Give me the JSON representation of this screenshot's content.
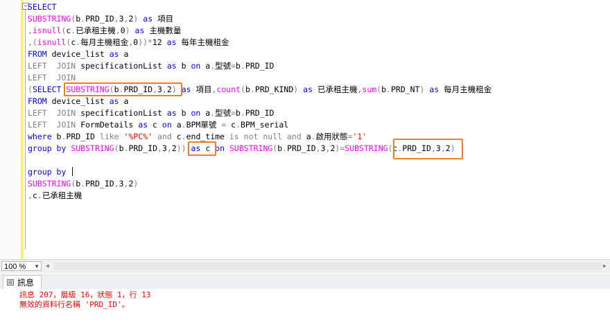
{
  "editor": {
    "lines": [
      [
        {
          "t": "SELECT",
          "c": "k"
        }
      ],
      [
        {
          "t": "SUBSTRING",
          "c": "f"
        },
        {
          "t": "(",
          "c": "g"
        },
        {
          "t": "b",
          "c": ""
        },
        {
          "t": ".",
          "c": "g"
        },
        {
          "t": "PRD_ID",
          "c": ""
        },
        {
          "t": ",",
          "c": "g"
        },
        {
          "t": "3",
          "c": ""
        },
        {
          "t": ",",
          "c": "g"
        },
        {
          "t": "2",
          "c": ""
        },
        {
          "t": ")",
          "c": "g"
        },
        {
          "t": " ",
          "c": ""
        },
        {
          "t": "as",
          "c": "k"
        },
        {
          "t": " 項目",
          "c": ""
        }
      ],
      [
        {
          "t": ",",
          "c": "g"
        },
        {
          "t": "isnull",
          "c": "f"
        },
        {
          "t": "(",
          "c": "g"
        },
        {
          "t": "c",
          "c": ""
        },
        {
          "t": ".",
          "c": "g"
        },
        {
          "t": "已承租主機",
          "c": ""
        },
        {
          "t": ",",
          "c": "g"
        },
        {
          "t": "0",
          "c": ""
        },
        {
          "t": ")",
          "c": "g"
        },
        {
          "t": " ",
          "c": ""
        },
        {
          "t": "as",
          "c": "k"
        },
        {
          "t": " 主機數量",
          "c": ""
        }
      ],
      [
        {
          "t": ",(",
          "c": "g"
        },
        {
          "t": "isnull",
          "c": "f"
        },
        {
          "t": "(",
          "c": "g"
        },
        {
          "t": "c",
          "c": ""
        },
        {
          "t": ".",
          "c": "g"
        },
        {
          "t": "每月主機租金",
          "c": ""
        },
        {
          "t": ",",
          "c": "g"
        },
        {
          "t": "0",
          "c": ""
        },
        {
          "t": "))*",
          "c": "g"
        },
        {
          "t": "12",
          "c": ""
        },
        {
          "t": " ",
          "c": ""
        },
        {
          "t": "as",
          "c": "k"
        },
        {
          "t": " 每年主機租金",
          "c": ""
        }
      ],
      [
        {
          "t": "FROM",
          "c": "k"
        },
        {
          "t": " device_list ",
          "c": ""
        },
        {
          "t": "as",
          "c": "k"
        },
        {
          "t": " a",
          "c": ""
        }
      ],
      [
        {
          "t": "LEFT  JOIN",
          "c": "g"
        },
        {
          "t": " specificationList ",
          "c": ""
        },
        {
          "t": "as",
          "c": "k"
        },
        {
          "t": " b ",
          "c": ""
        },
        {
          "t": "on",
          "c": "k"
        },
        {
          "t": " a",
          "c": ""
        },
        {
          "t": ".",
          "c": "g"
        },
        {
          "t": "型號",
          "c": ""
        },
        {
          "t": "=",
          "c": "g"
        },
        {
          "t": "b",
          "c": ""
        },
        {
          "t": ".",
          "c": "g"
        },
        {
          "t": "PRD_ID",
          "c": ""
        }
      ],
      [
        {
          "t": "LEFT  JOIN",
          "c": "g"
        }
      ],
      [
        {
          "t": "(",
          "c": "g"
        },
        {
          "t": "SELECT",
          "c": "k"
        },
        {
          "t": " ",
          "c": ""
        },
        {
          "t": "SUBSTRING",
          "c": "f"
        },
        {
          "t": "(",
          "c": "g"
        },
        {
          "t": "b",
          "c": ""
        },
        {
          "t": ".",
          "c": "g"
        },
        {
          "t": "PRD_ID",
          "c": ""
        },
        {
          "t": ",",
          "c": "g"
        },
        {
          "t": "3",
          "c": ""
        },
        {
          "t": ",",
          "c": "g"
        },
        {
          "t": "2",
          "c": ""
        },
        {
          "t": ")",
          "c": "g"
        },
        {
          "t": " ",
          "c": ""
        },
        {
          "t": "as",
          "c": "k"
        },
        {
          "t": " 項目",
          "c": ""
        },
        {
          "t": ",",
          "c": "g"
        },
        {
          "t": "count",
          "c": "f"
        },
        {
          "t": "(",
          "c": "g"
        },
        {
          "t": "b",
          "c": ""
        },
        {
          "t": ".",
          "c": "g"
        },
        {
          "t": "PRD_KIND",
          "c": ""
        },
        {
          "t": ")",
          "c": "g"
        },
        {
          "t": " ",
          "c": ""
        },
        {
          "t": "as",
          "c": "k"
        },
        {
          "t": " 已承租主機",
          "c": ""
        },
        {
          "t": ",",
          "c": "g"
        },
        {
          "t": "sum",
          "c": "f"
        },
        {
          "t": "(",
          "c": "g"
        },
        {
          "t": "b",
          "c": ""
        },
        {
          "t": ".",
          "c": "g"
        },
        {
          "t": "PRD_NT",
          "c": ""
        },
        {
          "t": ")",
          "c": "g"
        },
        {
          "t": " ",
          "c": ""
        },
        {
          "t": "as",
          "c": "k"
        },
        {
          "t": " 每月主機租金",
          "c": ""
        }
      ],
      [
        {
          "t": "FROM",
          "c": "k"
        },
        {
          "t": " device_list ",
          "c": ""
        },
        {
          "t": "as",
          "c": "k"
        },
        {
          "t": " a",
          "c": ""
        }
      ],
      [
        {
          "t": "LEFT  JOIN",
          "c": "g"
        },
        {
          "t": " specificationList ",
          "c": ""
        },
        {
          "t": "as",
          "c": "k"
        },
        {
          "t": " b ",
          "c": ""
        },
        {
          "t": "on",
          "c": "k"
        },
        {
          "t": " a",
          "c": ""
        },
        {
          "t": ".",
          "c": "g"
        },
        {
          "t": "型號",
          "c": ""
        },
        {
          "t": "=",
          "c": "g"
        },
        {
          "t": "b",
          "c": ""
        },
        {
          "t": ".",
          "c": "g"
        },
        {
          "t": "PRD_ID",
          "c": ""
        }
      ],
      [
        {
          "t": "LEFT  JOIN",
          "c": "g"
        },
        {
          "t": " FormDetails ",
          "c": ""
        },
        {
          "t": "as",
          "c": "k"
        },
        {
          "t": " c ",
          "c": ""
        },
        {
          "t": "on",
          "c": "k"
        },
        {
          "t": " a",
          "c": ""
        },
        {
          "t": ".",
          "c": "g"
        },
        {
          "t": "BPM單號 ",
          "c": ""
        },
        {
          "t": "=",
          "c": "g"
        },
        {
          "t": " c",
          "c": ""
        },
        {
          "t": ".",
          "c": "g"
        },
        {
          "t": "BPM_serial",
          "c": ""
        }
      ],
      [
        {
          "t": "where",
          "c": "k"
        },
        {
          "t": " b",
          "c": ""
        },
        {
          "t": ".",
          "c": "g"
        },
        {
          "t": "PRD_ID ",
          "c": ""
        },
        {
          "t": "like",
          "c": "g"
        },
        {
          "t": " ",
          "c": ""
        },
        {
          "t": "'%PC%'",
          "c": "s"
        },
        {
          "t": " ",
          "c": ""
        },
        {
          "t": "and",
          "c": "g"
        },
        {
          "t": " c",
          "c": ""
        },
        {
          "t": ".",
          "c": "g"
        },
        {
          "t": "end_time ",
          "c": ""
        },
        {
          "t": "is not null and",
          "c": "g"
        },
        {
          "t": " a",
          "c": ""
        },
        {
          "t": ".",
          "c": "g"
        },
        {
          "t": "啟用狀態",
          "c": ""
        },
        {
          "t": "=",
          "c": "g"
        },
        {
          "t": "'1'",
          "c": "s"
        }
      ],
      [
        {
          "t": "group by",
          "c": "k"
        },
        {
          "t": " ",
          "c": ""
        },
        {
          "t": "SUBSTRING",
          "c": "f"
        },
        {
          "t": "(",
          "c": "g"
        },
        {
          "t": "b",
          "c": ""
        },
        {
          "t": ".",
          "c": "g"
        },
        {
          "t": "PRD_ID",
          "c": ""
        },
        {
          "t": ",",
          "c": "g"
        },
        {
          "t": "3",
          "c": ""
        },
        {
          "t": ",",
          "c": "g"
        },
        {
          "t": "2",
          "c": ""
        },
        {
          "t": "))",
          "c": "g"
        },
        {
          "t": " ",
          "c": ""
        },
        {
          "t": "as",
          "c": "k"
        },
        {
          "t": " c ",
          "c": ""
        },
        {
          "t": "on",
          "c": "k"
        },
        {
          "t": " ",
          "c": ""
        },
        {
          "t": "SUBSTRING",
          "c": "f"
        },
        {
          "t": "(",
          "c": "g"
        },
        {
          "t": "b",
          "c": ""
        },
        {
          "t": ".",
          "c": "g"
        },
        {
          "t": "PRD_ID",
          "c": ""
        },
        {
          "t": ",",
          "c": "g"
        },
        {
          "t": "3",
          "c": ""
        },
        {
          "t": ",",
          "c": "g"
        },
        {
          "t": "2",
          "c": ""
        },
        {
          "t": ")=",
          "c": "g"
        },
        {
          "t": "SUBSTRING",
          "c": "f"
        },
        {
          "t": "(",
          "c": "g"
        },
        {
          "t": "c",
          "c": ""
        },
        {
          "t": ".",
          "c": "g"
        },
        {
          "t": "PRD_ID",
          "c": ""
        },
        {
          "t": ",",
          "c": "g"
        },
        {
          "t": "3",
          "c": ""
        },
        {
          "t": ",",
          "c": "g"
        },
        {
          "t": "2",
          "c": ""
        },
        {
          "t": ")",
          "c": "g"
        }
      ],
      [],
      [
        {
          "t": "group by",
          "c": "k"
        },
        {
          "t": " ",
          "c": ""
        },
        {
          "t": "|caret|",
          "c": "caret"
        }
      ],
      [
        {
          "t": "SUBSTRING",
          "c": "f"
        },
        {
          "t": "(",
          "c": "g"
        },
        {
          "t": "b",
          "c": ""
        },
        {
          "t": ".",
          "c": "g"
        },
        {
          "t": "PRD_ID",
          "c": ""
        },
        {
          "t": ",",
          "c": "g"
        },
        {
          "t": "3",
          "c": ""
        },
        {
          "t": ",",
          "c": "g"
        },
        {
          "t": "2",
          "c": ""
        },
        {
          "t": ")",
          "c": "g"
        }
      ],
      [
        {
          "t": ",",
          "c": "g"
        },
        {
          "t": "c",
          "c": ""
        },
        {
          "t": ".",
          "c": "g"
        },
        {
          "t": "已承租主機",
          "c": ""
        }
      ]
    ],
    "highlight_color": "#f07f22"
  },
  "statusbar": {
    "zoom_value": "100 %"
  },
  "results": {
    "tab_label": "訊息",
    "messages": [
      "訊息 207，層級 16，狀態 1，行 13",
      "無效的資料行名稱 'PRD_ID'。"
    ],
    "error_color": "#ff0000"
  }
}
